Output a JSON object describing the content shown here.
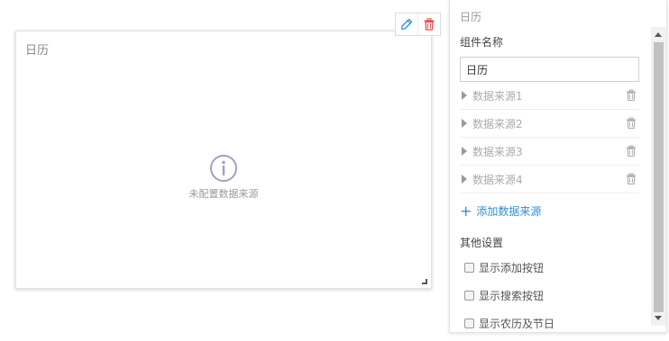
{
  "widget": {
    "title": "日历",
    "empty_text": "未配置数据来源"
  },
  "toolbar": {
    "edit_icon": "pencil-icon",
    "delete_icon": "trash-icon",
    "delete_color": "#e05050",
    "edit_color": "#2b8fd6"
  },
  "panel": {
    "title": "日历",
    "name_label": "组件名称",
    "name_value": "日历",
    "data_sources": [
      {
        "label": "数据来源1"
      },
      {
        "label": "数据来源2"
      },
      {
        "label": "数据来源3"
      },
      {
        "label": "数据来源4"
      }
    ],
    "add_source_label": "添加数据来源",
    "other_settings_label": "其他设置",
    "options": [
      {
        "label": "显示添加按钮",
        "checked": false
      },
      {
        "label": "显示搜索按钮",
        "checked": false
      },
      {
        "label": "显示农历及节日",
        "checked": false
      }
    ]
  },
  "colors": {
    "accent": "#2b8fd6",
    "info_icon": "#a99cc5"
  }
}
